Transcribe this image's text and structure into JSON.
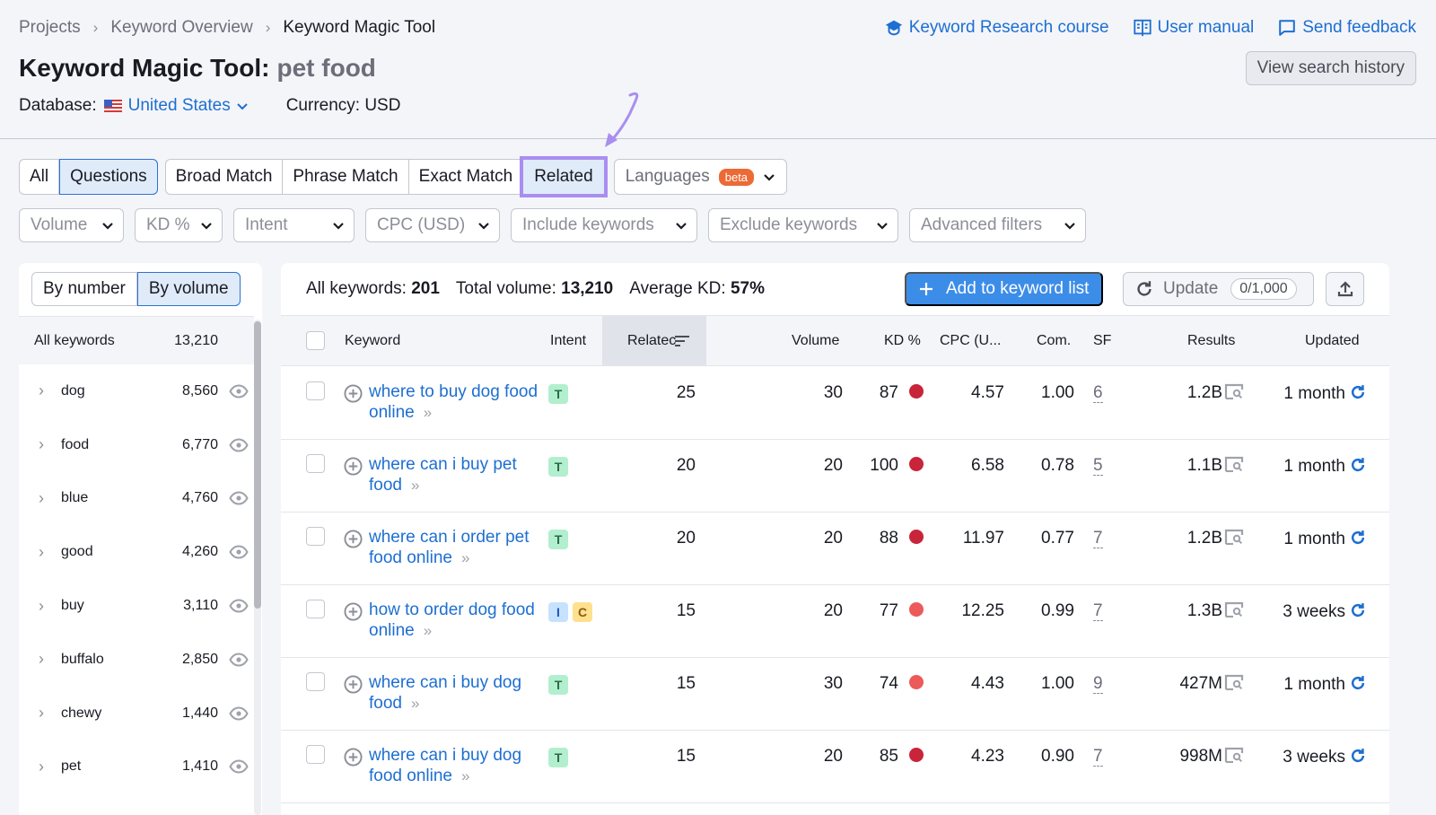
{
  "breadcrumb": [
    "Projects",
    "Keyword Overview",
    "Keyword Magic Tool"
  ],
  "top_links": {
    "course": "Keyword Research course",
    "manual": "User manual",
    "feedback": "Send feedback"
  },
  "title": {
    "tool": "Keyword Magic Tool:",
    "query": "pet food"
  },
  "history_button": "View search history",
  "database": {
    "label": "Database:",
    "country": "United States",
    "currency": "Currency: USD"
  },
  "match_tabs": {
    "group1": [
      "All",
      "Questions"
    ],
    "group2": [
      "Broad Match",
      "Phrase Match",
      "Exact Match",
      "Related"
    ],
    "active": [
      "Questions",
      "Related"
    ]
  },
  "languages": {
    "label": "Languages",
    "badge": "beta"
  },
  "filters": [
    "Volume",
    "KD %",
    "Intent",
    "CPC (USD)",
    "Include keywords",
    "Exclude keywords",
    "Advanced filters"
  ],
  "left_panel": {
    "toggle": [
      "By number",
      "By volume"
    ],
    "active_toggle": "By volume",
    "all_label": "All keywords",
    "all_count": "13,210",
    "groups": [
      {
        "name": "dog",
        "count": "8,560"
      },
      {
        "name": "food",
        "count": "6,770"
      },
      {
        "name": "blue",
        "count": "4,760"
      },
      {
        "name": "good",
        "count": "4,260"
      },
      {
        "name": "buy",
        "count": "3,110"
      },
      {
        "name": "buffalo",
        "count": "2,850"
      },
      {
        "name": "chewy",
        "count": "1,440"
      },
      {
        "name": "pet",
        "count": "1,410"
      }
    ]
  },
  "summary": {
    "all_keywords_label": "All keywords:",
    "all_keywords": "201",
    "total_volume_label": "Total volume:",
    "total_volume": "13,210",
    "avg_kd_label": "Average KD:",
    "avg_kd": "57%"
  },
  "actions": {
    "add": "Add to keyword list",
    "update": "Update",
    "update_quota": "0/1,000"
  },
  "columns": {
    "keyword": "Keyword",
    "intent": "Intent",
    "related": "Relatec",
    "volume": "Volume",
    "kd": "KD %",
    "cpc": "CPC (U...",
    "com": "Com.",
    "sf": "SF",
    "results": "Results",
    "updated": "Updated"
  },
  "colors": {
    "kd_very_hard": "#c8243a",
    "kd_hard": "#ec5a5a",
    "accent": "#1d6fd1",
    "highlight": "#a98ef0"
  },
  "rows": [
    {
      "keyword": "where to buy dog food online",
      "intents": [
        "T"
      ],
      "related": "25",
      "volume": "30",
      "kd": "87",
      "kd_level": "very_hard",
      "cpc": "4.57",
      "com": "1.00",
      "sf": "6",
      "results": "1.2B",
      "updated": "1 month"
    },
    {
      "keyword": "where can i buy pet food",
      "intents": [
        "T"
      ],
      "related": "20",
      "volume": "20",
      "kd": "100",
      "kd_level": "very_hard",
      "cpc": "6.58",
      "com": "0.78",
      "sf": "5",
      "results": "1.1B",
      "updated": "1 month"
    },
    {
      "keyword": "where can i order pet food online",
      "intents": [
        "T"
      ],
      "related": "20",
      "volume": "20",
      "kd": "88",
      "kd_level": "very_hard",
      "cpc": "11.97",
      "com": "0.77",
      "sf": "7",
      "results": "1.2B",
      "updated": "1 month"
    },
    {
      "keyword": "how to order dog food online",
      "intents": [
        "I",
        "C"
      ],
      "related": "15",
      "volume": "20",
      "kd": "77",
      "kd_level": "hard",
      "cpc": "12.25",
      "com": "0.99",
      "sf": "7",
      "results": "1.3B",
      "updated": "3 weeks"
    },
    {
      "keyword": "where can i buy dog food",
      "intents": [
        "T"
      ],
      "related": "15",
      "volume": "30",
      "kd": "74",
      "kd_level": "hard",
      "cpc": "4.43",
      "com": "1.00",
      "sf": "9",
      "results": "427M",
      "updated": "1 month"
    },
    {
      "keyword": "where can i buy dog food online",
      "intents": [
        "T"
      ],
      "related": "15",
      "volume": "20",
      "kd": "85",
      "kd_level": "very_hard",
      "cpc": "4.23",
      "com": "0.90",
      "sf": "7",
      "results": "998M",
      "updated": "3 weeks"
    }
  ]
}
